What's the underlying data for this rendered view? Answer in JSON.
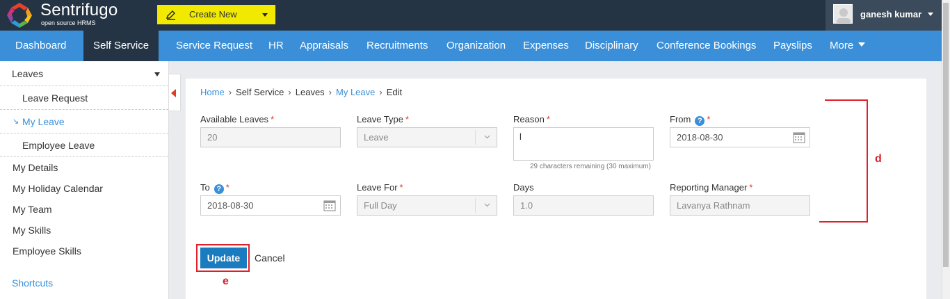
{
  "app": {
    "brand": "Sentrifugo",
    "tagline": "open source HRMS"
  },
  "topbar": {
    "create_label": "Create New",
    "user_name": "ganesh kumar"
  },
  "nav": {
    "items": [
      "Dashboard",
      "Self Service",
      "Service Request",
      "HR",
      "Appraisals",
      "Recruitments",
      "Organization",
      "Expenses",
      "Disciplinary",
      "Conference Bookings",
      "Payslips",
      "More"
    ],
    "active": "Self Service"
  },
  "sidebar": {
    "section": "Leaves",
    "sub_items": [
      "Leave Request",
      "My Leave",
      "Employee Leave"
    ],
    "active_sub": "My Leave",
    "items": [
      "My Details",
      "My Holiday Calendar",
      "My Team",
      "My Skills",
      "Employee Skills"
    ],
    "shortcuts": "Shortcuts"
  },
  "breadcrumb": [
    "Home",
    "Self Service",
    "Leaves",
    "My Leave",
    "Edit"
  ],
  "form": {
    "available_leaves": {
      "label": "Available Leaves",
      "value": "20"
    },
    "leave_type": {
      "label": "Leave Type",
      "value": "Leave"
    },
    "reason": {
      "label": "Reason",
      "value": "l",
      "hint": "29 characters remaining (30 maximum)"
    },
    "from": {
      "label": "From",
      "value": "2018-08-30"
    },
    "to": {
      "label": "To",
      "value": "2018-08-30"
    },
    "leave_for": {
      "label": "Leave For",
      "value": "Full Day"
    },
    "days": {
      "label": "Days",
      "value": "1.0"
    },
    "reporting_manager": {
      "label": "Reporting Manager",
      "value": "Lavanya Rathnam"
    },
    "required_mark": "*",
    "help_glyph": "?"
  },
  "actions": {
    "update": "Update",
    "cancel": "Cancel"
  },
  "annotations": {
    "d": "d",
    "e": "e"
  },
  "colors": {
    "topbar": "#253444",
    "nav": "#3b8fd8",
    "accent_yellow": "#f1e900",
    "annotation_red": "#e0202b",
    "button_blue": "#1b7bbf"
  },
  "icons": {
    "calendar": "calendar-icon",
    "dropdown": "chevron-down-icon",
    "help": "help-icon",
    "logo": "logo-icon"
  }
}
